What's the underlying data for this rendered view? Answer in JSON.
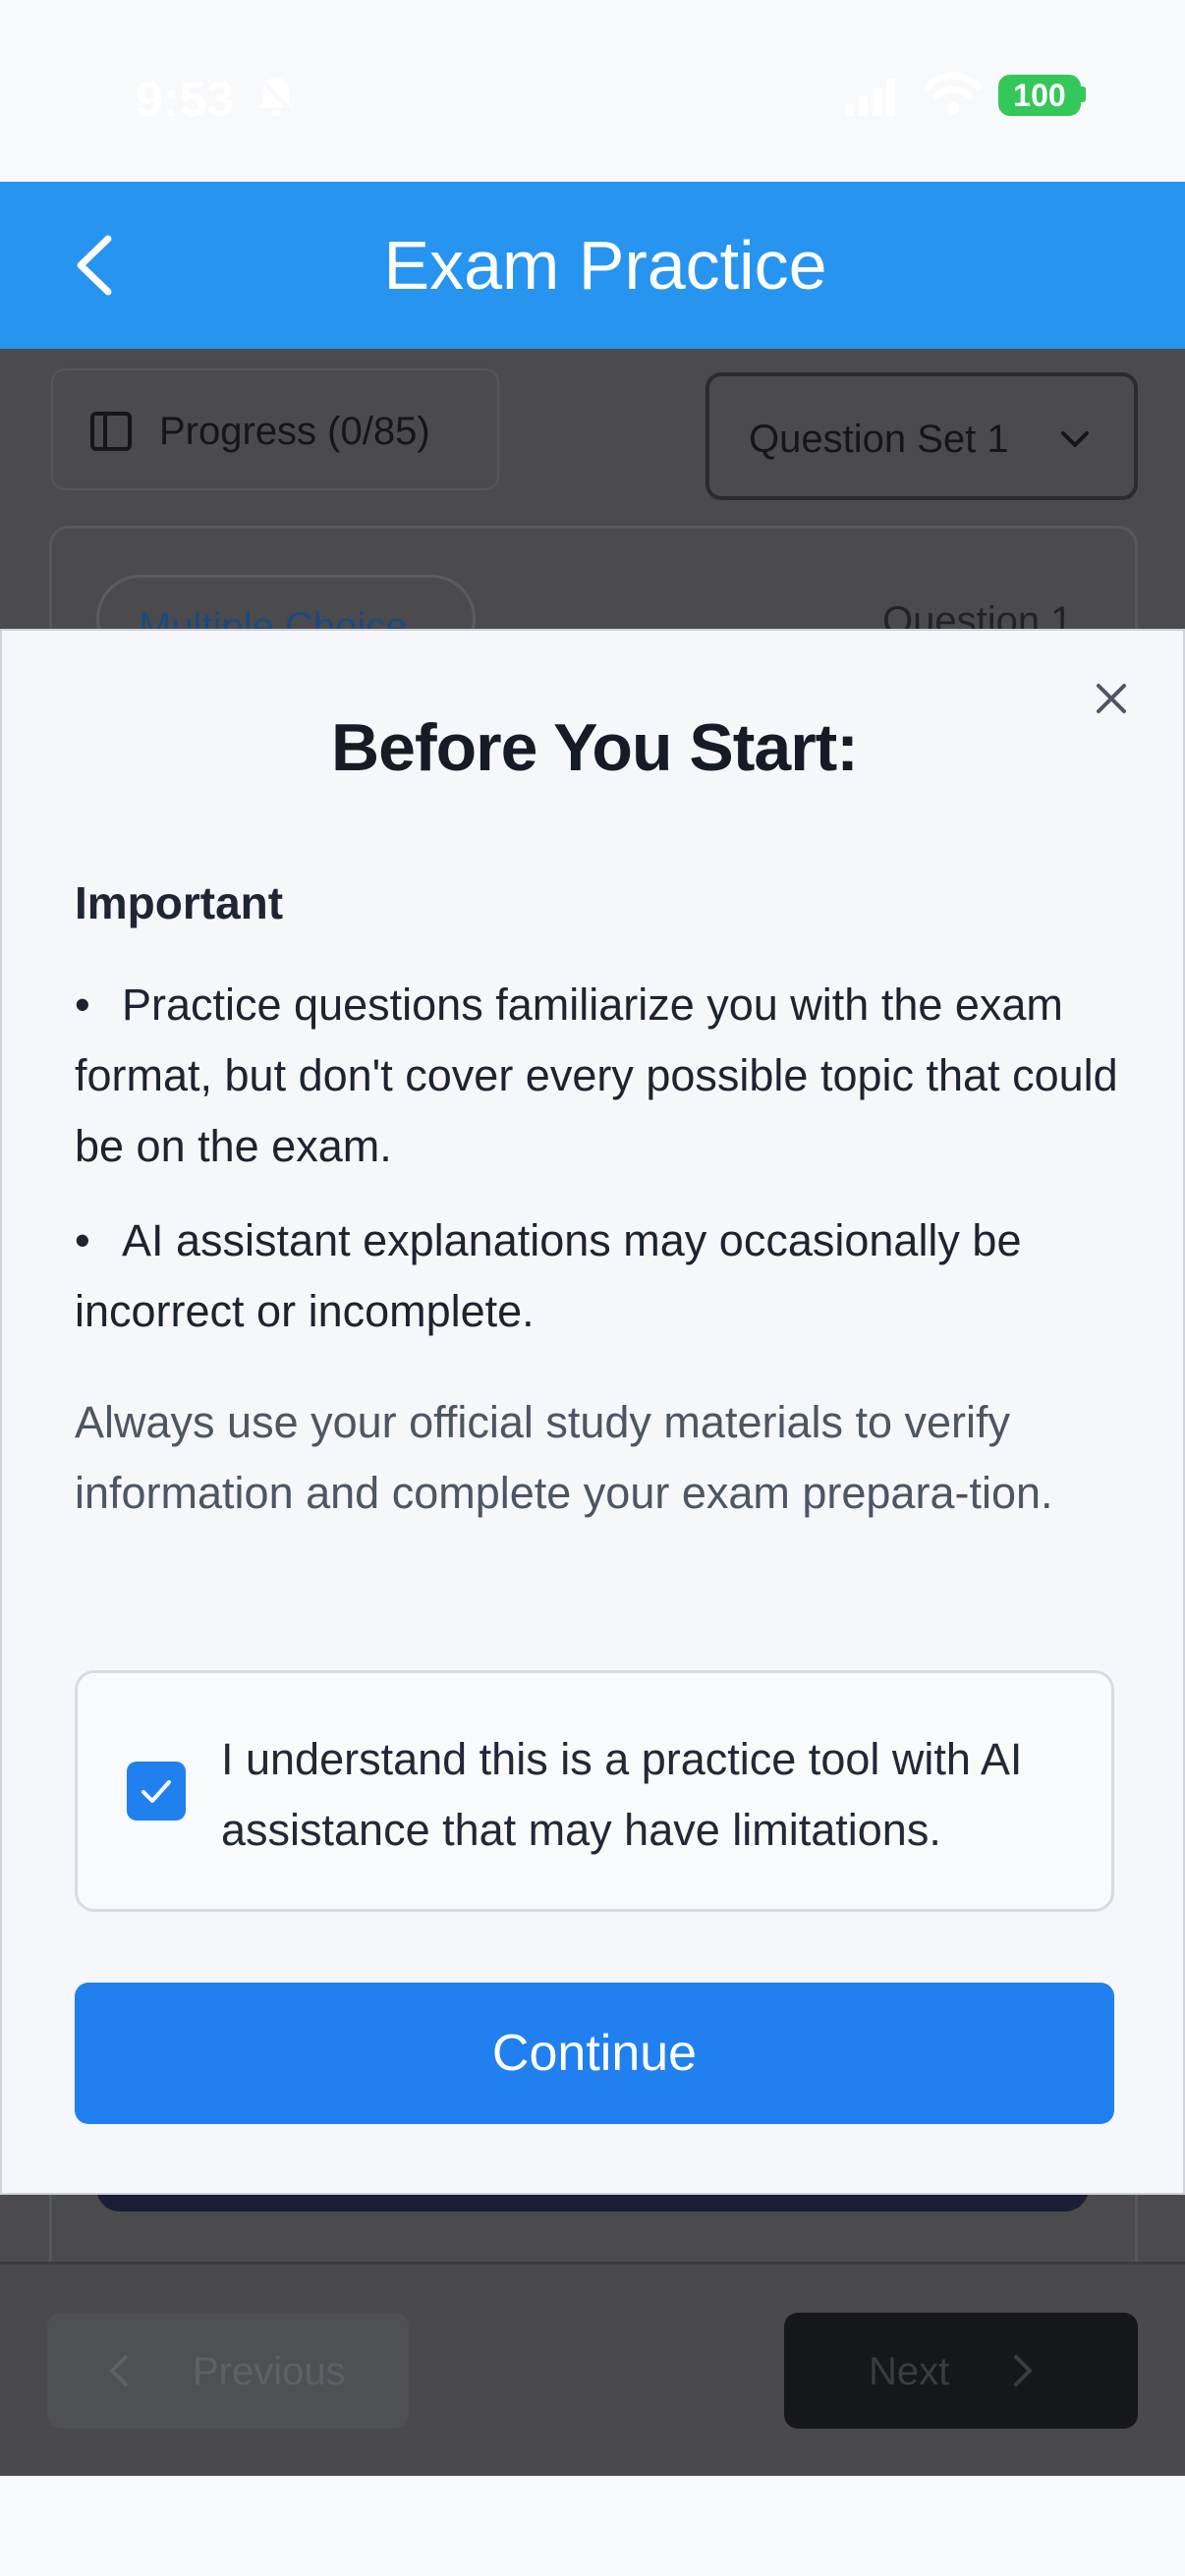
{
  "status_bar": {
    "time": "9:53",
    "battery": "100",
    "battery_color": "#34c759"
  },
  "header": {
    "title": "Exam Practice",
    "back_icon": "chevron-left-icon",
    "color": "#2794f0"
  },
  "background": {
    "progress_label": "Progress (0/85)",
    "question_set_selected": "Question Set 1",
    "question_type_badge": "Multiple Choice",
    "question_number": "Question 1",
    "previous_label": "Previous",
    "next_label": "Next"
  },
  "modal": {
    "title": "Before You Start:",
    "important_heading": "Important",
    "bullets": [
      "Practice questions familiarize you with the exam format, but don't cover every possible topic that could be on the exam.",
      "AI assistant explanations may occasionally be incorrect or incomplete."
    ],
    "disclaimer": "Always use your official study materials to verify information and complete your exam prepara-tion.",
    "acknowledgement": {
      "text": "I understand this is a practice tool with AI assistance that may have limitations.",
      "checked": true
    },
    "continue_label": "Continue",
    "accent_color": "#2080f0"
  }
}
